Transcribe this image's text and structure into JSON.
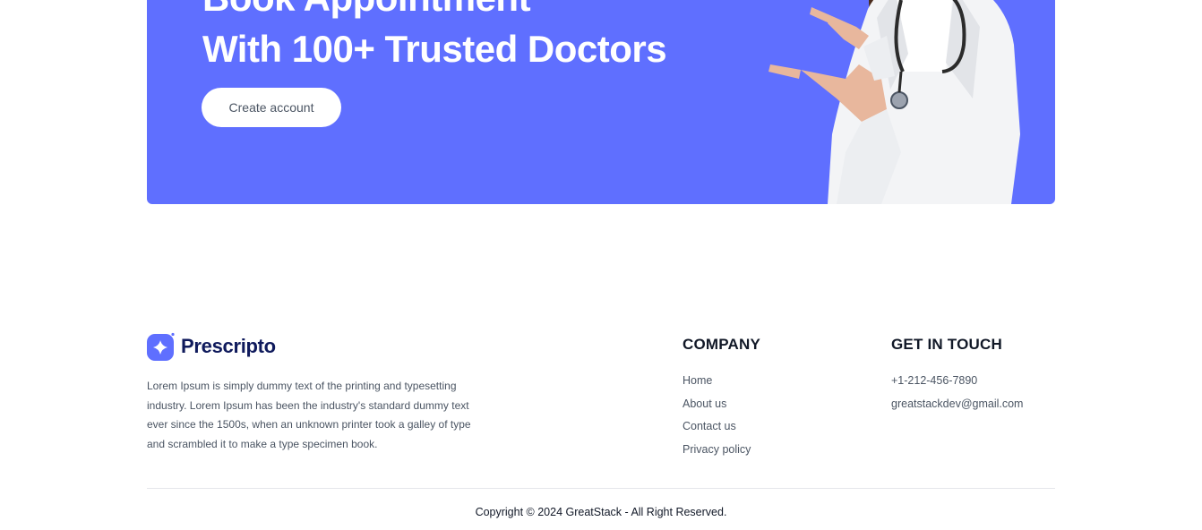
{
  "banner": {
    "line1": "Book Appointment",
    "line2": "With 100+ Trusted Doctors",
    "cta_label": "Create account",
    "bg_color": "#5f6fff"
  },
  "footer": {
    "brand": "Prescripto",
    "about": "Lorem Ipsum is simply dummy text of the printing and typesetting industry. Lorem Ipsum has been the industry's standard dummy text ever since the 1500s, when an unknown printer took a galley of type and scrambled it to make a type specimen book.",
    "company": {
      "title": "COMPANY",
      "links": [
        "Home",
        "About us",
        "Contact us",
        "Privacy policy"
      ]
    },
    "contact": {
      "title": "GET IN TOUCH",
      "phone": "+1-212-456-7890",
      "email": "greatstackdev@gmail.com"
    },
    "copyright": "Copyright © 2024 GreatStack - All Right Reserved."
  }
}
